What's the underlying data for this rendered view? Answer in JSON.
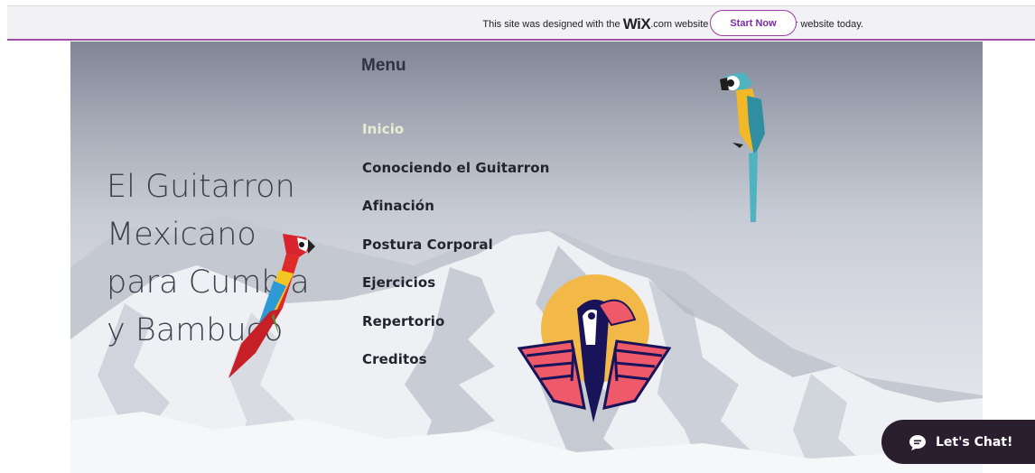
{
  "banner": {
    "text_before": "This site was designed with the ",
    "brand": "WiX",
    "text_after": ".com website builder. Create your website today.",
    "cta": "Start Now"
  },
  "hero": {
    "title_lines": [
      "El Guitarron",
      "Mexicano",
      "para Cumbia",
      "y Bambuco"
    ]
  },
  "menu": {
    "heading": "Menu",
    "items": [
      {
        "label": "Inicio",
        "active": true
      },
      {
        "label": "Conociendo el Guitarron",
        "active": false
      },
      {
        "label": "Afinación",
        "active": false
      },
      {
        "label": "Postura Corporal",
        "active": false
      },
      {
        "label": "Ejercicios",
        "active": false
      },
      {
        "label": "Repertorio",
        "active": false
      },
      {
        "label": "Creditos",
        "active": false
      }
    ]
  },
  "chat": {
    "label": "Let's Chat!",
    "icon": "chat-bubble-icon"
  },
  "illustrations": [
    "blue-yellow-macaw-icon",
    "red-macaw-icon",
    "toucan-emblem-icon"
  ],
  "colors": {
    "banner_accent": "#a24da6",
    "active_menu": "#e6eed0",
    "chat_bg": "#2a1f2f"
  }
}
